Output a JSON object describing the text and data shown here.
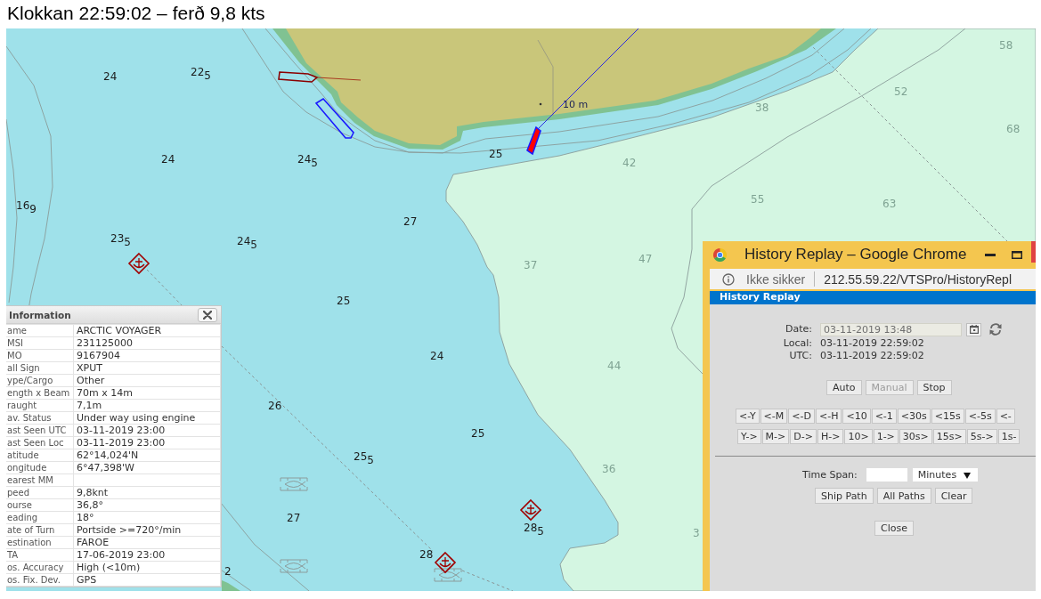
{
  "caption": "Klokkan 22:59:02 – ferð 9,8 kts",
  "chart": {
    "soundings": [
      {
        "text": "24",
        "kind": "shallow"
      },
      {
        "text": "22$_{5}$",
        "kind": "shallow"
      },
      {
        "text": "24",
        "kind": "shallow"
      },
      {
        "text": "24$_{5}$",
        "kind": "shallow"
      },
      {
        "text": "25",
        "kind": "shallow"
      },
      {
        "text": "16$_{9}$",
        "kind": "shallow"
      },
      {
        "text": "23$_{5}$",
        "kind": "shallow"
      },
      {
        "text": "24$_{5}$",
        "kind": "shallow"
      },
      {
        "text": "27",
        "kind": "shallow"
      },
      {
        "text": "25",
        "kind": "shallow"
      },
      {
        "text": "24",
        "kind": "shallow"
      },
      {
        "text": "26",
        "kind": "shallow"
      },
      {
        "text": "25",
        "kind": "shallow"
      },
      {
        "text": "25$_{5}$",
        "kind": "shallow"
      },
      {
        "text": "27",
        "kind": "shallow"
      },
      {
        "text": "28$_{5}$",
        "kind": "shallow"
      },
      {
        "text": "28",
        "kind": "shallow"
      },
      {
        "text": "2",
        "kind": "shallow"
      },
      {
        "text": "58",
        "kind": "deep"
      },
      {
        "text": "52",
        "kind": "deep"
      },
      {
        "text": "68",
        "kind": "deep"
      },
      {
        "text": "38",
        "kind": "deep"
      },
      {
        "text": "42",
        "kind": "deep"
      },
      {
        "text": "55",
        "kind": "deep"
      },
      {
        "text": "63",
        "kind": "deep"
      },
      {
        "text": "37",
        "kind": "deep"
      },
      {
        "text": "47",
        "kind": "deep"
      },
      {
        "text": "44",
        "kind": "deep"
      },
      {
        "text": "36",
        "kind": "deep"
      },
      {
        "text": "3",
        "kind": "deep"
      }
    ],
    "distance_label": "10 m"
  },
  "info_panel": {
    "title": "Information",
    "rows": [
      {
        "label": "ame",
        "value": "ARCTIC VOYAGER"
      },
      {
        "label": "MSI",
        "value": "231125000"
      },
      {
        "label": "MO",
        "value": "9167904"
      },
      {
        "label": "all Sign",
        "value": "XPUT"
      },
      {
        "label": "ype/Cargo",
        "value": "Other"
      },
      {
        "label": "ength x Beam",
        "value": "70m x 14m"
      },
      {
        "label": "raught",
        "value": "7,1m"
      },
      {
        "label": "av. Status",
        "value": "Under way using engine"
      },
      {
        "label": "ast Seen UTC",
        "value": "03-11-2019 23:00"
      },
      {
        "label": "ast Seen Loc",
        "value": "03-11-2019 23:00"
      },
      {
        "label": "atitude",
        "value": "62°14,024'N"
      },
      {
        "label": "ongitude",
        "value": "6°47,398'W"
      },
      {
        "label": "earest MM"
      },
      {
        "label": "peed",
        "value": "9,8knt"
      },
      {
        "label": "ourse",
        "value": "36,8°"
      },
      {
        "label": "eading",
        "value": "18°"
      },
      {
        "label": "ate of Turn",
        "value": "Portside >=720°/min"
      },
      {
        "label": "estination",
        "value": "FAROE"
      },
      {
        "label": "TA",
        "value": "17-06-2019 23:00"
      },
      {
        "label": "os. Accuracy",
        "value": "High (<10m)"
      },
      {
        "label": "os. Fix. Dev.",
        "value": "GPS"
      }
    ]
  },
  "replay_window": {
    "title": "History Replay – Google Chrome",
    "security_label": "Ikke sikker",
    "url": "212.55.59.22/VTSPro/HistoryRepl",
    "header": "History Replay",
    "date": {
      "label": "Date:",
      "value": "03-11-2019 13:48",
      "disabled": true
    },
    "times": [
      {
        "label": "Local:",
        "value": "03-11-2019 22:59:02"
      },
      {
        "label": "UTC:",
        "value": "03-11-2019 22:59:02"
      }
    ],
    "mode_buttons": [
      {
        "label": "Auto",
        "disabled": false
      },
      {
        "label": "Manual",
        "disabled": true
      },
      {
        "label": "Stop",
        "disabled": false
      }
    ],
    "back_buttons": [
      "<-Y",
      "<-M",
      "<-D",
      "<-H",
      "<10",
      "<-1",
      "<30s",
      "<15s",
      "<-5s",
      "<-"
    ],
    "forward_buttons": [
      "Y->",
      "M->",
      "D->",
      "H->",
      "10>",
      "1->",
      "30s>",
      "15s>",
      "5s->",
      "1s-"
    ],
    "time_span": {
      "label": "Time Span:",
      "unit": "Minutes"
    },
    "path_buttons": [
      "Ship Path",
      "All Paths",
      "Clear"
    ],
    "close_button": "Close"
  }
}
